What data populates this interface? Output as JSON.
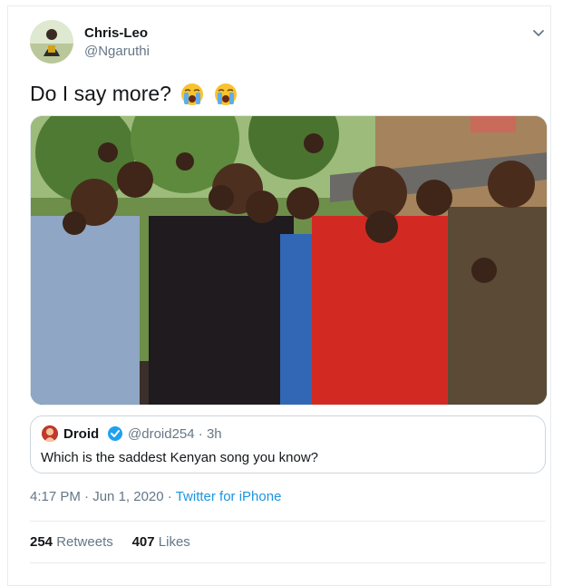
{
  "author": {
    "name": "Chris-Leo",
    "handle": "@Ngaruthi"
  },
  "tweet": {
    "text": "Do I say more?",
    "emojis": [
      "loudly-crying-face",
      "loudly-crying-face"
    ]
  },
  "quoted": {
    "name": "Droid",
    "handle": "@droid254",
    "separator": "·",
    "time": "3h",
    "text": "Which is the saddest Kenyan song you know?"
  },
  "meta": {
    "time": "4:17 PM",
    "dot": "·",
    "date": "Jun 1, 2020",
    "dot2": "·",
    "source": "Twitter for iPhone"
  },
  "stats": {
    "retweets_count": "254",
    "retweets_label": "Retweets",
    "likes_count": "407",
    "likes_label": "Likes"
  },
  "colors": {
    "link": "#1b95e0",
    "secondary": "#657786",
    "border": "#e6ecf0"
  }
}
